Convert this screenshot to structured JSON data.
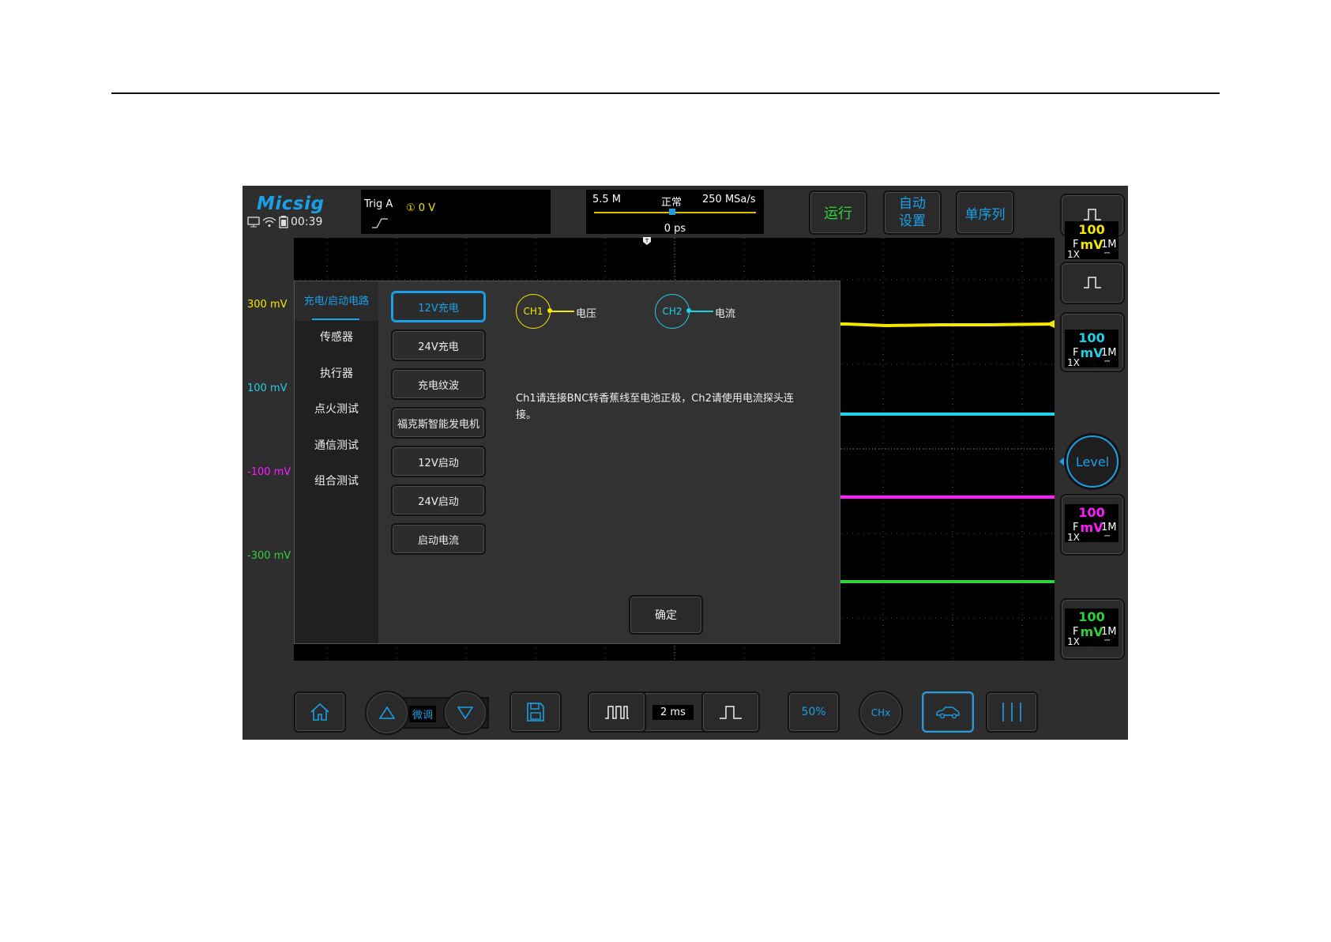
{
  "brand": "Micsig",
  "status": {
    "time": "00:39"
  },
  "trigger": {
    "label": "Trig  A",
    "level": "① 0  V"
  },
  "acquisition": {
    "depth": "5.5 M",
    "mode": "正常",
    "rate": "250 MSa/s",
    "offset": "0 ps"
  },
  "top_buttons": {
    "run": "运行",
    "auto_line1": "自动",
    "auto_line2": "设置",
    "sequence": "单序列"
  },
  "voltage_markers": [
    {
      "label": "300 mV",
      "color": "#f5e600"
    },
    {
      "label": "100 mV",
      "color": "#1fd1e6"
    },
    {
      "label": "-100 mV",
      "color": "#ff1aff"
    },
    {
      "label": "-300 mV",
      "color": "#2fd23a"
    }
  ],
  "dialog": {
    "categories": [
      "充电/启动电路",
      "传感器",
      "执行器",
      "点火测试",
      "通信测试",
      "组合测试"
    ],
    "selected_category": "充电/启动电路",
    "subitems": [
      "12V充电",
      "24V充电",
      "充电纹波",
      "福克斯智能发电机",
      "12V启动",
      "24V启动",
      "启动电流"
    ],
    "selected_subitem": "12V充电",
    "ch1": {
      "name": "CH1",
      "signal": "电压",
      "color": "#f5e600"
    },
    "ch2": {
      "name": "CH2",
      "signal": "电流",
      "color": "#1fd1e6"
    },
    "instruction": "Ch1请连接BNC转香蕉线至电池正极，Ch2请使用电流探头连接。",
    "confirm": "确定"
  },
  "channels": [
    {
      "scale": "100 mV",
      "coupling": "F",
      "impedance": "1M",
      "probe": "1X",
      "color": "#f5e600"
    },
    {
      "scale": "100 mV",
      "coupling": "F",
      "impedance": "1M",
      "probe": "1X",
      "color": "#1fd1e6"
    },
    {
      "scale": "100 mV",
      "coupling": "F",
      "impedance": "1M",
      "probe": "1X",
      "color": "#ff1aff"
    },
    {
      "scale": "100 mV",
      "coupling": "F",
      "impedance": "1M",
      "probe": "1X",
      "color": "#2fd23a"
    }
  ],
  "level_button": "Level",
  "bottom": {
    "fine": "微调",
    "timebase": "2 ms",
    "fifty": "50%",
    "chx": "CHx"
  },
  "icons": [
    "monitor-icon",
    "wifi-icon",
    "battery-icon",
    "home-icon",
    "up-triangle-icon",
    "down-triangle-icon",
    "save-icon",
    "wide-pulse-icon",
    "narrow-pulse-icon",
    "car-icon",
    "cursor-icon"
  ]
}
